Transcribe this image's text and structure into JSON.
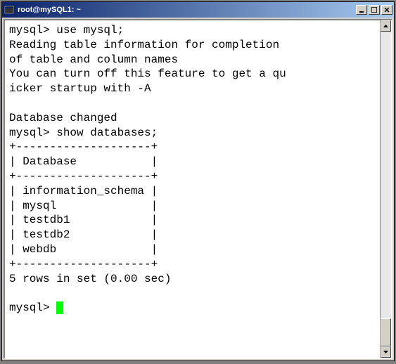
{
  "window": {
    "title": "root@mySQL1: ~"
  },
  "lines": {
    "l0": "mysql> use mysql;",
    "l1": "Reading table information for completion",
    "l2": "of table and column names",
    "l3": "You can turn off this feature to get a qu",
    "l4": "icker startup with -A",
    "l5": "",
    "l6": "Database changed",
    "l7": "mysql> show databases;",
    "l8": "+--------------------+",
    "l9": "| Database           |",
    "l10": "+--------------------+",
    "l11": "| information_schema |",
    "l12": "| mysql              |",
    "l13": "| testdb1            |",
    "l14": "| testdb2            |",
    "l15": "| webdb              |",
    "l16": "+--------------------+",
    "l17": "5 rows in set (0.00 sec)",
    "l18": "",
    "l19": "mysql> "
  }
}
